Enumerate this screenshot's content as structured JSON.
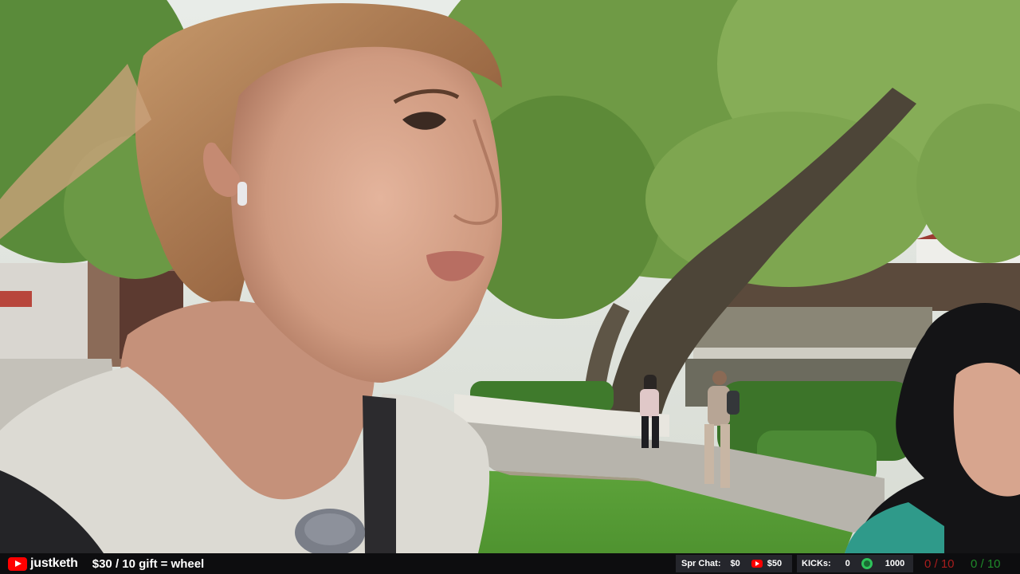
{
  "overlay": {
    "channel_icon": "youtube-logo-icon",
    "channel_name": "justketh",
    "promo_text": "$30 / 10 gift = wheel",
    "superchat_label": "Spr Chat:",
    "superchat_value": "$0",
    "superchat_yt_icon": "youtube-logo-icon",
    "superchat_yt_value": "$50",
    "kicks_label": "KICKs:",
    "kicks_value": "0",
    "kicks_icon": "green-globe-icon",
    "kicks_goal": "1000",
    "score_red": "0 / 10",
    "score_green": "0 / 10"
  },
  "colors": {
    "bar_background": "#0d0d0f",
    "stat_box_background": "#25262c",
    "youtube_red": "#ff0000",
    "score_red": "#a81d1d",
    "score_green": "#1f8a2a"
  }
}
